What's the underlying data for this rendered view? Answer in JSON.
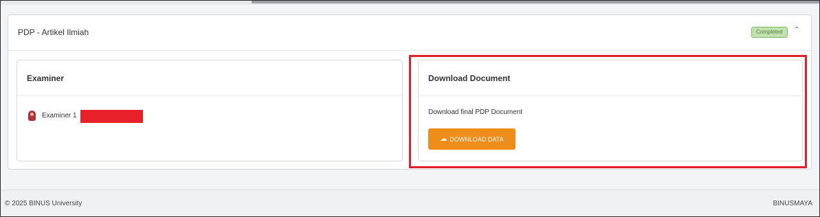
{
  "card": {
    "title": "PDP - Artikel Ilmiah",
    "status_badge": "Completed",
    "collapse_icon": "chevron-up-icon"
  },
  "examiner_panel": {
    "title": "Examiner",
    "examiners": [
      {
        "label": "Examiner 1",
        "avatar_icon": "user-avatar-icon"
      }
    ]
  },
  "download_panel": {
    "title": "Download Document",
    "description": "Download final PDP Document",
    "button_label": "DOWNLOAD DATA",
    "button_icon": "cloud-download-icon"
  },
  "footer": {
    "copyright": "© 2025 BINUS University",
    "brand": "BINUSMAYA"
  },
  "colors": {
    "accent_orange": "#ef8d1b",
    "badge_green_bg": "#c4e2b0",
    "badge_green_text": "#4e7d3c",
    "highlight_red": "#e0202c",
    "redaction_red": "#e8202a"
  }
}
